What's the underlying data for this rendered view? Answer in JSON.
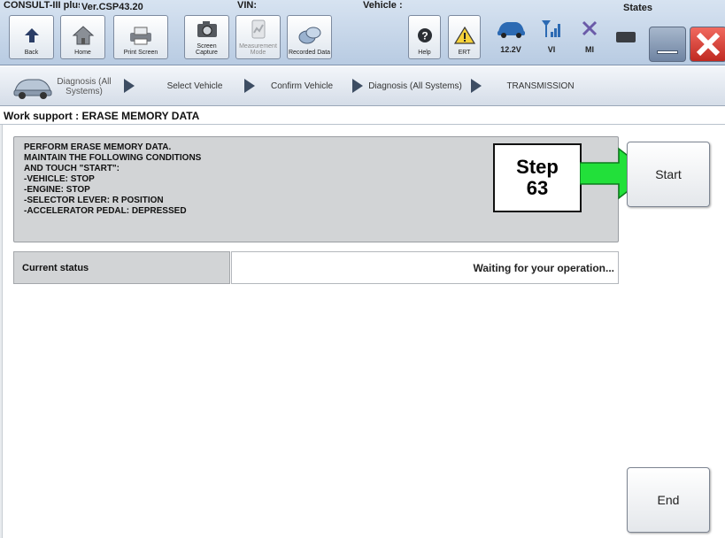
{
  "toolbar": {
    "top_texts": [
      "CONSULT-III plus",
      "Ver.CSP43.20",
      "VIN:",
      "Vehicle :",
      "States"
    ],
    "buttons": [
      {
        "label": "Back",
        "icon": "back-arrow-icon",
        "enabled": true
      },
      {
        "label": "Home",
        "icon": "home-icon",
        "enabled": true
      },
      {
        "label": "Print Screen",
        "icon": "printer-icon",
        "enabled": true
      },
      {
        "label": "Screen Capture",
        "icon": "camera-icon",
        "enabled": true
      },
      {
        "label": "Measurement Mode",
        "icon": "measurement-icon",
        "enabled": false
      },
      {
        "label": "Recorded Data",
        "icon": "recorded-data-icon",
        "enabled": true
      },
      {
        "label": "Help",
        "icon": "help-icon",
        "enabled": true
      },
      {
        "label": "ERT",
        "icon": "warning-icon",
        "enabled": true
      }
    ],
    "status": [
      {
        "label": "12.2V",
        "icon": "car-battery-icon"
      },
      {
        "label": "VI",
        "icon": "signal-icon"
      },
      {
        "label": "MI",
        "icon": "mi-x-icon"
      }
    ]
  },
  "breadcrumb": [
    {
      "label": "Diagnosis (All Systems)"
    },
    {
      "label": "Select Vehicle"
    },
    {
      "label": "Confirm Vehicle"
    },
    {
      "label": "Diagnosis (All Systems)"
    },
    {
      "label": "TRANSMISSION"
    }
  ],
  "work_support": {
    "title": "Work support : ERASE MEMORY DATA",
    "instructions": [
      "PERFORM ERASE MEMORY DATA.",
      "MAINTAIN THE FOLLOWING CONDITIONS",
      "AND TOUCH \"START\":",
      "-VEHICLE: STOP",
      "-ENGINE: STOP",
      "-SELECTOR LEVER: R POSITION",
      "-ACCELERATOR PEDAL: DEPRESSED"
    ],
    "status_label": "Current status",
    "status_value": "Waiting for your operation..."
  },
  "callout": {
    "line1": "Step",
    "line2": "63",
    "arrow_color": "#22e03a"
  },
  "buttons": {
    "start": "Start",
    "end": "End"
  },
  "colors": {
    "close": "#e0322b",
    "arrow": "#22e03a"
  }
}
